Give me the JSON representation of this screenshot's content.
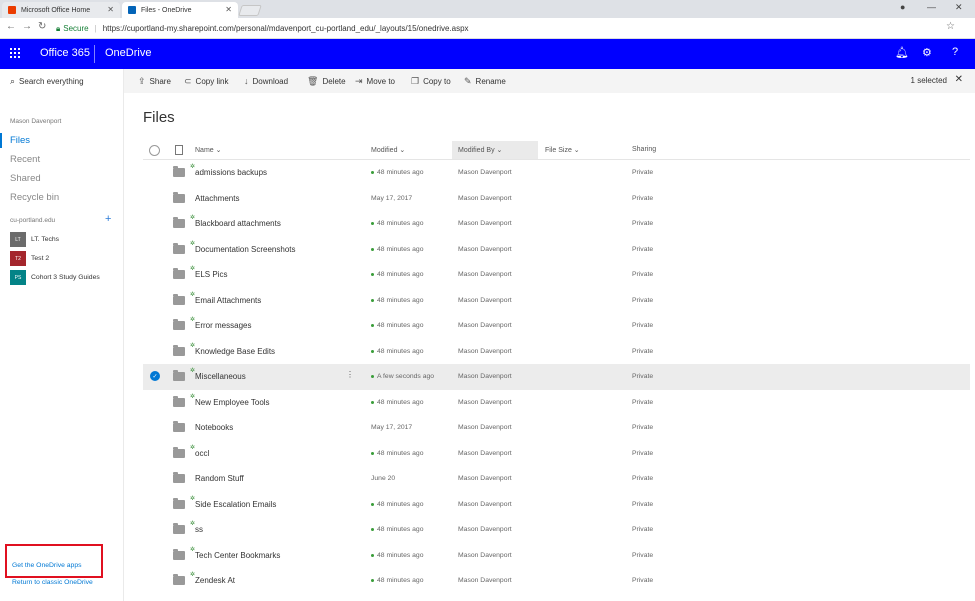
{
  "browser": {
    "tabs": [
      {
        "title": "Microsoft Office Home",
        "active": false,
        "favicon_color": "#eb3c00"
      },
      {
        "title": "Files - OneDrive",
        "active": true,
        "favicon_color": "#0364b8"
      }
    ],
    "secure_label": "Secure",
    "url": "https://cuportland-my.sharepoint.com/personal/mdavenport_cu-portland_edu/_layouts/15/onedrive.aspx"
  },
  "suitebar": {
    "brand": "Office 365",
    "app": "OneDrive",
    "color": "#0000ff"
  },
  "leftnav": {
    "search_placeholder": "Search everything",
    "user": "Mason Davenport",
    "items": [
      {
        "label": "Files",
        "selected": true
      },
      {
        "label": "Recent",
        "selected": false
      },
      {
        "label": "Shared",
        "selected": false
      },
      {
        "label": "Recycle bin",
        "selected": false
      }
    ],
    "groups_header": "cu-portland.edu",
    "groups": [
      {
        "initials": "LT",
        "label": "LT. Techs",
        "color": "#6b6b6b"
      },
      {
        "initials": "T2",
        "label": "Test 2",
        "color": "#a4262c"
      },
      {
        "initials": "PS",
        "label": "Cohort 3 Study Guides",
        "color": "#038387"
      }
    ],
    "get_apps": "Get the OneDrive apps",
    "classic": "Return to classic OneDrive"
  },
  "commandbar": {
    "commands": [
      "Share",
      "Copy link",
      "Download",
      "Delete",
      "Move to",
      "Copy to",
      "Rename"
    ],
    "selection": "1 selected"
  },
  "main": {
    "title": "Files",
    "columns": {
      "name": "Name",
      "modified": "Modified",
      "modified_by": "Modified By",
      "file_size": "File Size",
      "sharing": "Sharing"
    },
    "rows": [
      {
        "name": "admissions backups",
        "modified": "48 minutes ago",
        "by": "Mason Davenport",
        "sharing": "Private",
        "new": true,
        "selected": false
      },
      {
        "name": "Attachments",
        "modified": "May 17, 2017",
        "by": "Mason Davenport",
        "sharing": "Private",
        "new": false,
        "selected": false
      },
      {
        "name": "Blackboard attachments",
        "modified": "48 minutes ago",
        "by": "Mason Davenport",
        "sharing": "Private",
        "new": true,
        "selected": false
      },
      {
        "name": "Documentation Screenshots",
        "modified": "48 minutes ago",
        "by": "Mason Davenport",
        "sharing": "Private",
        "new": true,
        "selected": false
      },
      {
        "name": "ELS Pics",
        "modified": "48 minutes ago",
        "by": "Mason Davenport",
        "sharing": "Private",
        "new": true,
        "selected": false
      },
      {
        "name": "Email Attachments",
        "modified": "48 minutes ago",
        "by": "Mason Davenport",
        "sharing": "Private",
        "new": true,
        "selected": false
      },
      {
        "name": "Error messages",
        "modified": "48 minutes ago",
        "by": "Mason Davenport",
        "sharing": "Private",
        "new": true,
        "selected": false
      },
      {
        "name": "Knowledge Base Edits",
        "modified": "48 minutes ago",
        "by": "Mason Davenport",
        "sharing": "Private",
        "new": true,
        "selected": false
      },
      {
        "name": "Miscellaneous",
        "modified": "A few seconds ago",
        "by": "Mason Davenport",
        "sharing": "Private",
        "new": true,
        "selected": true
      },
      {
        "name": "New Employee Tools",
        "modified": "48 minutes ago",
        "by": "Mason Davenport",
        "sharing": "Private",
        "new": true,
        "selected": false
      },
      {
        "name": "Notebooks",
        "modified": "May 17, 2017",
        "by": "Mason Davenport",
        "sharing": "Private",
        "new": false,
        "selected": false
      },
      {
        "name": "occl",
        "modified": "48 minutes ago",
        "by": "Mason Davenport",
        "sharing": "Private",
        "new": true,
        "selected": false
      },
      {
        "name": "Random Stuff",
        "modified": "June 20",
        "by": "Mason Davenport",
        "sharing": "Private",
        "new": false,
        "selected": false
      },
      {
        "name": "Side Escalation Emails",
        "modified": "48 minutes ago",
        "by": "Mason Davenport",
        "sharing": "Private",
        "new": true,
        "selected": false
      },
      {
        "name": "ss",
        "modified": "48 minutes ago",
        "by": "Mason Davenport",
        "sharing": "Private",
        "new": true,
        "selected": false
      },
      {
        "name": "Tech Center Bookmarks",
        "modified": "48 minutes ago",
        "by": "Mason Davenport",
        "sharing": "Private",
        "new": true,
        "selected": false
      },
      {
        "name": "Zendesk At",
        "modified": "48 minutes ago",
        "by": "Mason Davenport",
        "sharing": "Private",
        "new": true,
        "selected": false
      }
    ]
  }
}
